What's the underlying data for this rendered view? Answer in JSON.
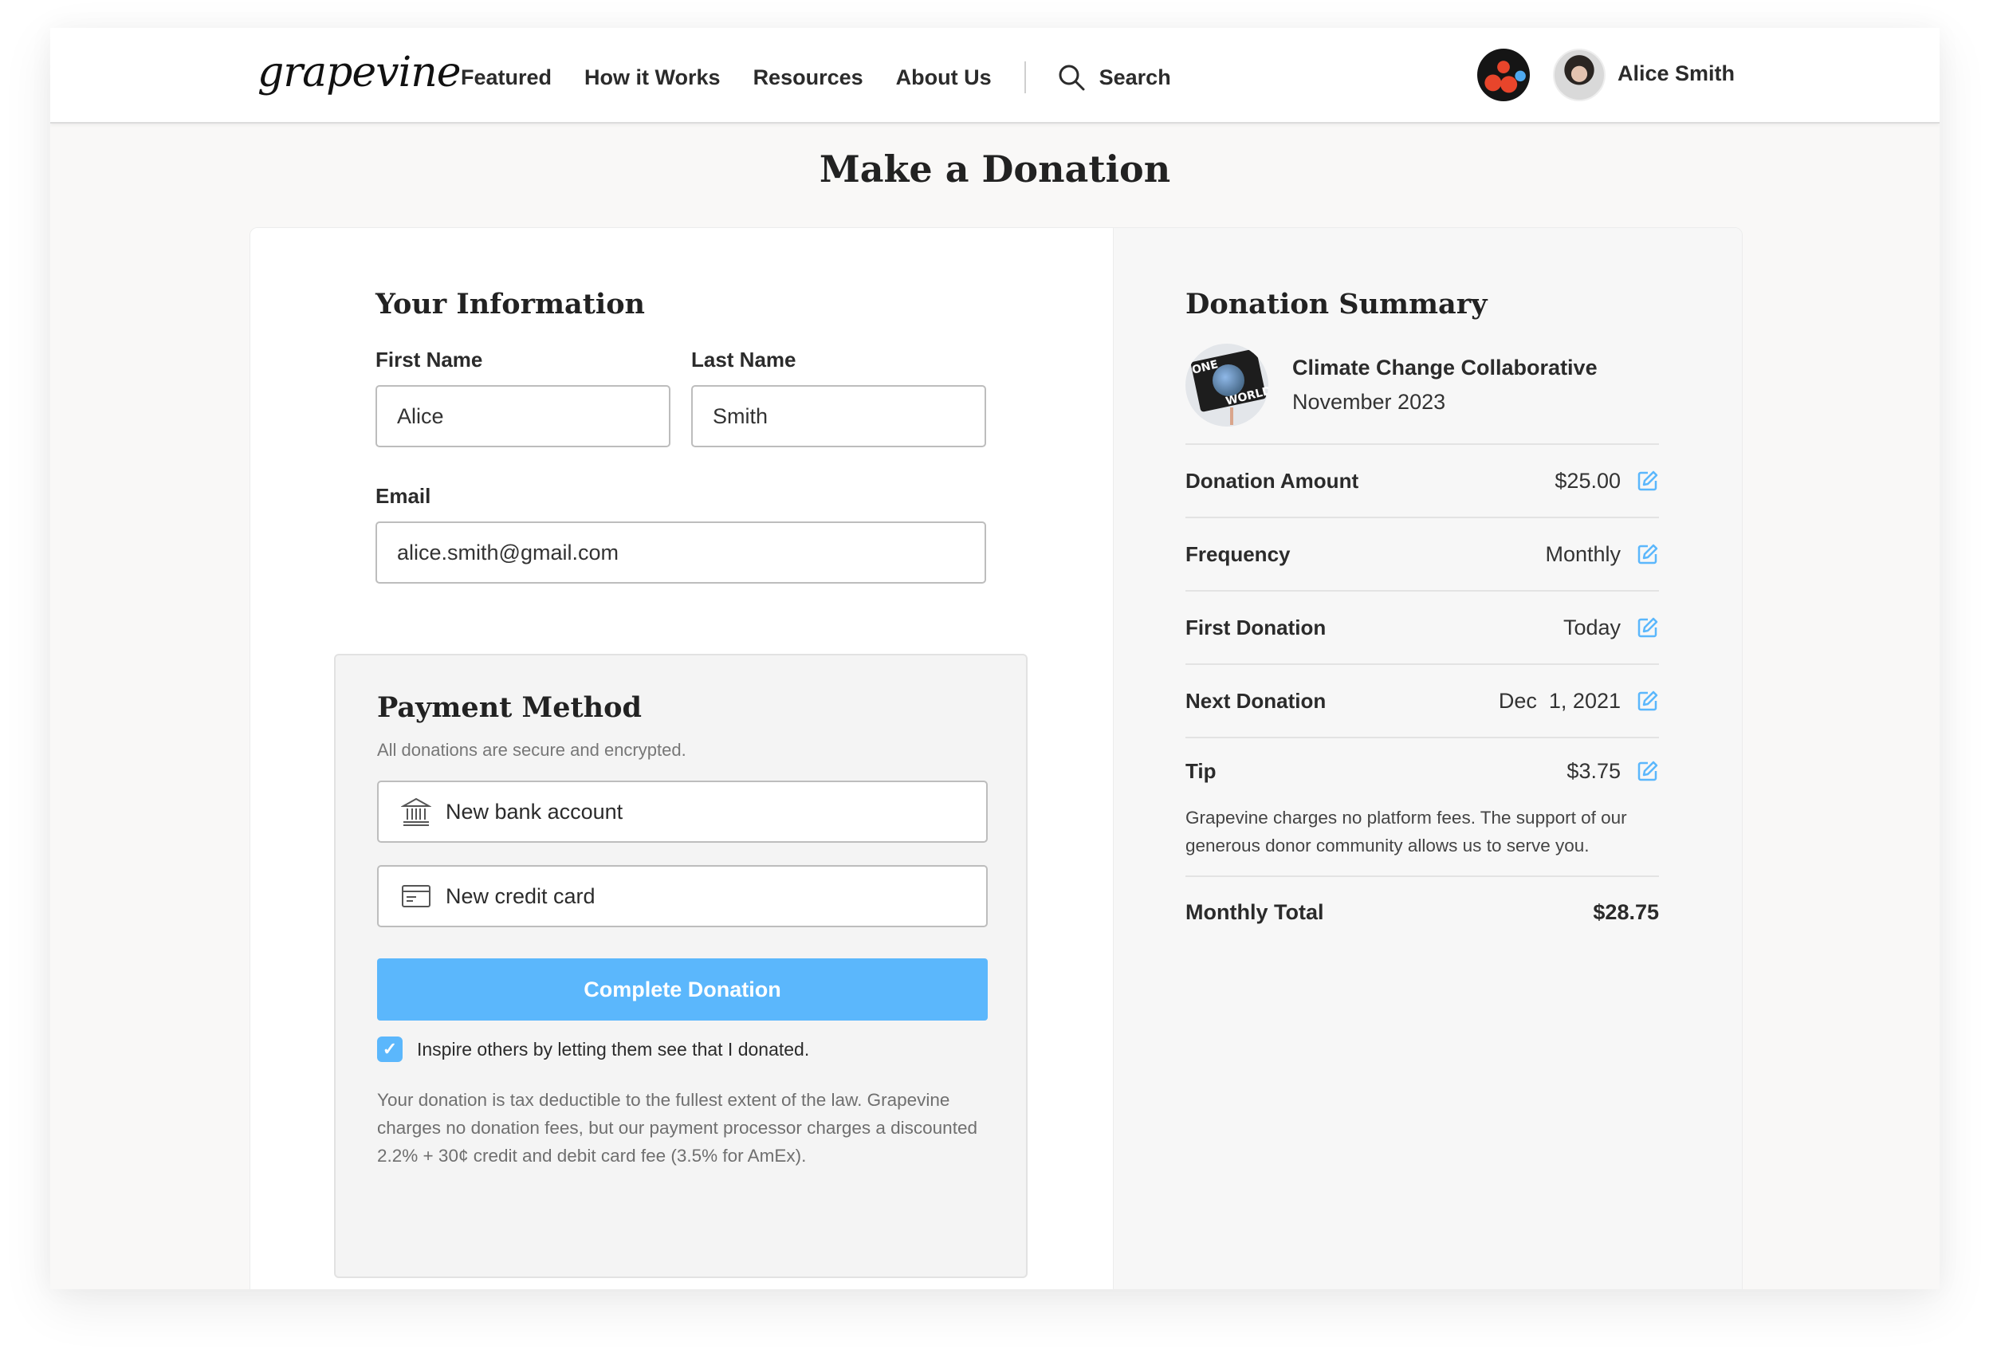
{
  "header": {
    "logo": "grapevine",
    "nav": [
      "Featured",
      "How it Works",
      "Resources",
      "About Us"
    ],
    "search_label": "Search",
    "user_name": "Alice Smith"
  },
  "page": {
    "title": "Make a Donation"
  },
  "info": {
    "title": "Your Information",
    "first_name_label": "First Name",
    "first_name_value": "Alice",
    "last_name_label": "Last Name",
    "last_name_value": "Smith",
    "email_label": "Email",
    "email_value": "alice.smith@gmail.com"
  },
  "payment": {
    "title": "Payment Method",
    "subtitle": "All donations are secure and encrypted.",
    "options": [
      {
        "label": "New bank account",
        "icon": "bank-icon"
      },
      {
        "label": "New credit card",
        "icon": "credit-card-icon"
      }
    ],
    "complete_label": "Complete Donation",
    "inspire_checked": true,
    "inspire_label": "Inspire others by letting them see that I donated.",
    "disclaimer": "Your donation is tax deductible to the fullest extent of the law. Grapevine charges no donation fees, but our payment processor charges a discounted 2.2% + 30¢ credit and debit card fee (3.5% for AmEx)."
  },
  "summary": {
    "title": "Donation Summary",
    "org_name": "Climate Change Collaborative",
    "org_date": "November 2023",
    "org_logo_text": [
      "ONE",
      "WORLD"
    ],
    "rows": [
      {
        "label": "Donation Amount",
        "value": "$25.00"
      },
      {
        "label": "Frequency",
        "value": "Monthly"
      },
      {
        "label": "First Donation",
        "value": "Today"
      },
      {
        "label": "Next Donation",
        "value": "Dec  1, 2021"
      },
      {
        "label": "Tip",
        "value": "$3.75"
      }
    ],
    "tip_note": "Grapevine charges no platform fees. The support of our generous donor community allows us to serve you.",
    "total_label": "Monthly Total",
    "total_value": "$28.75"
  },
  "colors": {
    "accent": "#5bb7fc",
    "edit_icon": "#5bb7fc",
    "text": "#2b2b2b"
  }
}
